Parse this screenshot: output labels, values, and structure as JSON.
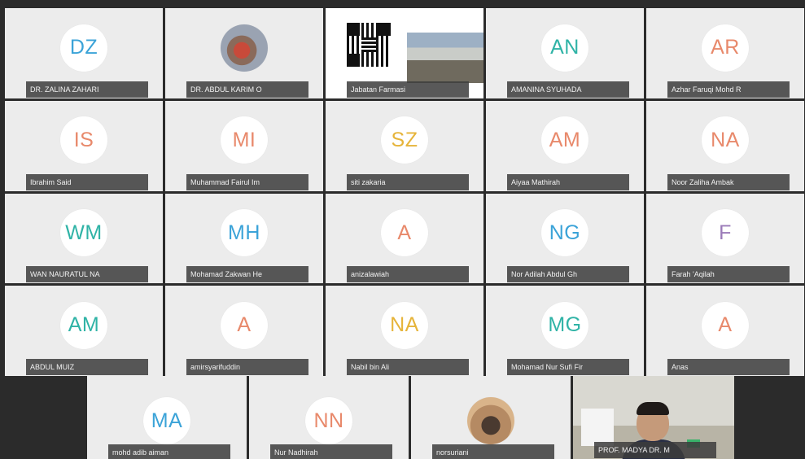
{
  "participants": [
    {
      "initials": "DZ",
      "name": "DR. ZALINA ZAHARI",
      "color": "#3ba3d8"
    },
    {
      "initials": "",
      "name": "DR. ABDUL KARIM O",
      "avatar": "photo"
    },
    {
      "initials": "",
      "name": "Jabatan Farmasi",
      "avatar": "qr-code"
    },
    {
      "initials": "AN",
      "name": "AMANINA SYUHADA",
      "color": "#2fb3a6"
    },
    {
      "initials": "AR",
      "name": "Azhar Faruqi Mohd R",
      "color": "#e8896b"
    },
    {
      "initials": "IS",
      "name": "Ibrahim Said",
      "color": "#e8896b"
    },
    {
      "initials": "MI",
      "name": "Muhammad Fairul Im",
      "color": "#e8896b"
    },
    {
      "initials": "SZ",
      "name": "siti zakaria",
      "color": "#e6b43a"
    },
    {
      "initials": "AM",
      "name": "Aiyaa Mathirah",
      "color": "#e8896b"
    },
    {
      "initials": "NA",
      "name": "Noor Zaliha Ambak",
      "color": "#e8896b"
    },
    {
      "initials": "WM",
      "name": "WAN NAURATUL NA",
      "color": "#2fb3a6"
    },
    {
      "initials": "MH",
      "name": "Mohamad Zakwan He",
      "color": "#3ba3d8"
    },
    {
      "initials": "A",
      "name": "anizalawiah",
      "color": "#e8896b"
    },
    {
      "initials": "NG",
      "name": "Nor Adilah Abdul Gh",
      "color": "#3ba3d8"
    },
    {
      "initials": "F",
      "name": "Farah 'Aqilah",
      "color": "#9a7ab8"
    },
    {
      "initials": "AM",
      "name": "ABDUL MUIZ",
      "color": "#2fb3a6"
    },
    {
      "initials": "A",
      "name": "amirsyarifuddin",
      "color": "#e8896b"
    },
    {
      "initials": "NA",
      "name": "Nabil bin Ali",
      "color": "#e6b43a"
    },
    {
      "initials": "MG",
      "name": "Mohamad Nur Sufi Fir",
      "color": "#2fb3a6"
    },
    {
      "initials": "A",
      "name": "Anas",
      "color": "#e8896b"
    }
  ],
  "bottom_row": [
    {
      "initials": "MA",
      "name": "mohd adib aiman",
      "color": "#3ba3d8"
    },
    {
      "initials": "NN",
      "name": "Nur Nadhirah",
      "color": "#e8896b"
    },
    {
      "initials": "",
      "name": "norsuriani",
      "avatar": "photo"
    },
    {
      "name": "PROF. MADYA DR. M",
      "avatar": "video"
    }
  ]
}
